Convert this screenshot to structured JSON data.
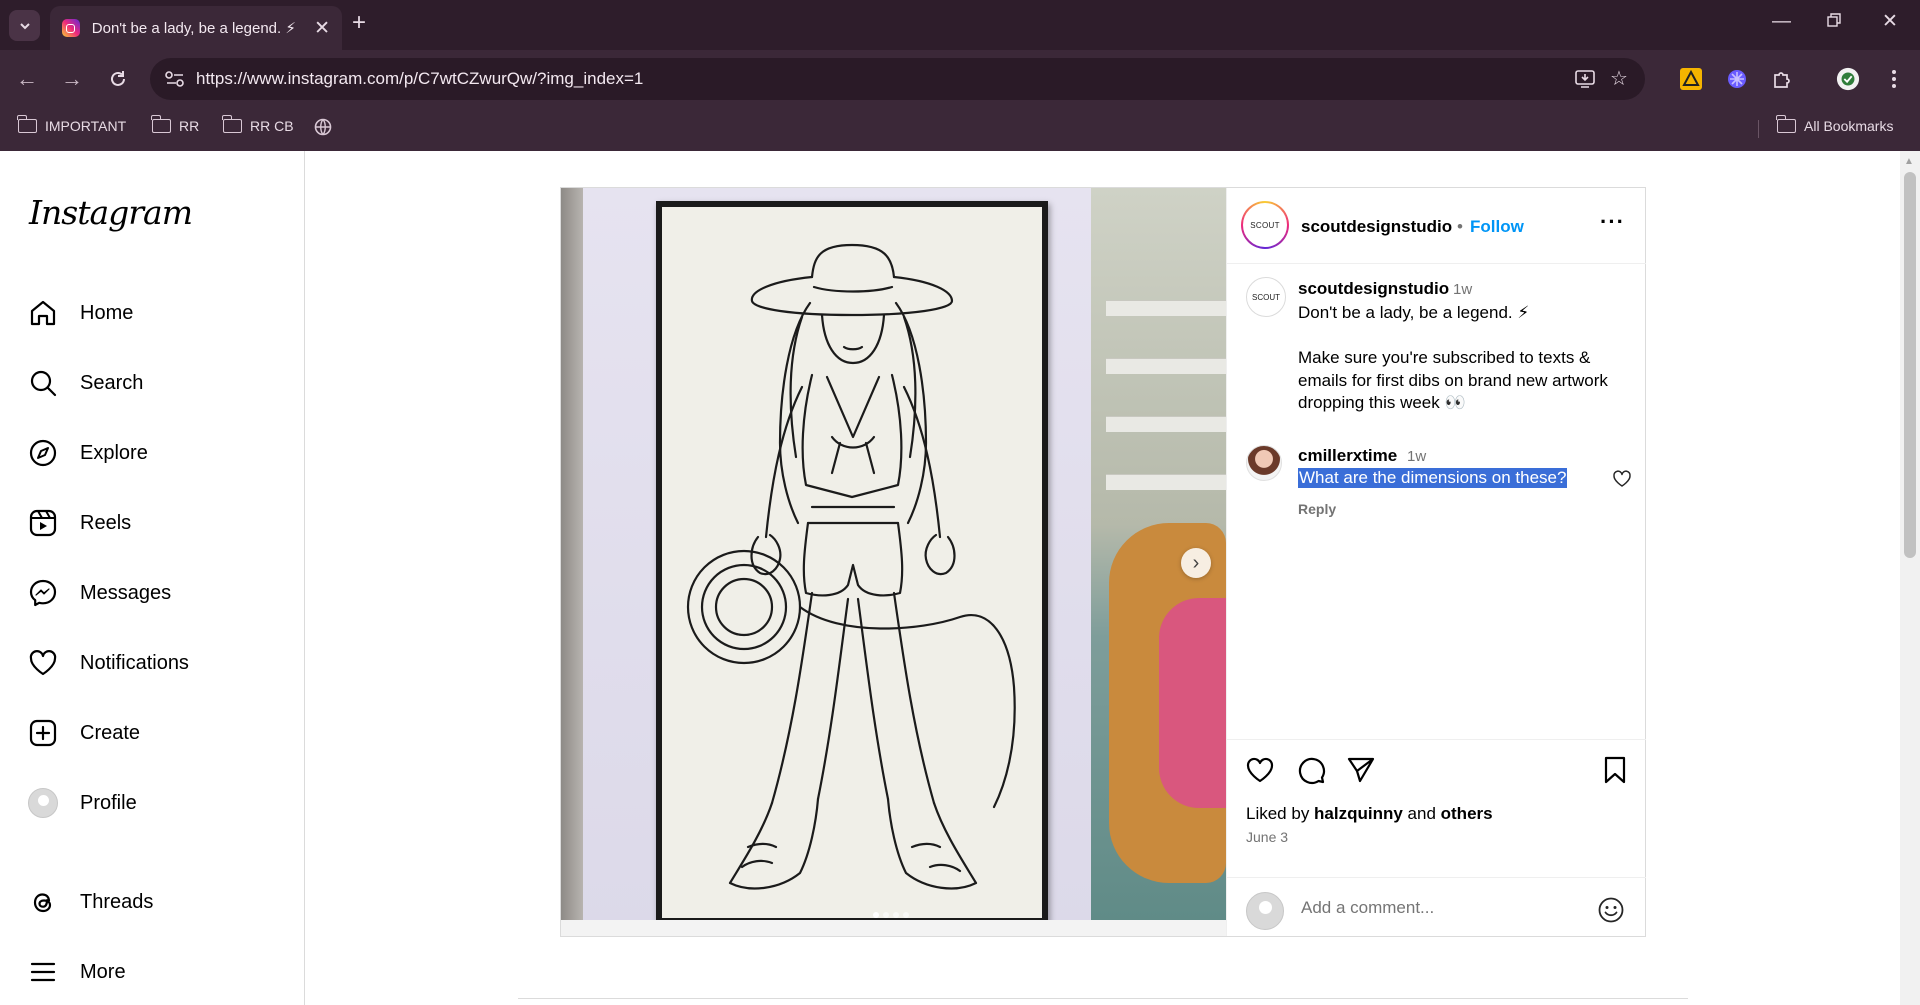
{
  "browser": {
    "tab_title": "Don't be a lady, be a legend. ⚡",
    "url": "https://www.instagram.com/p/C7wtCZwurQw/?img_index=1",
    "bookmarks": [
      "IMPORTANT",
      "RR",
      "RR CB"
    ],
    "all_bookmarks": "All Bookmarks"
  },
  "sidebar": {
    "logo": "Instagram",
    "items": [
      {
        "label": "Home",
        "icon": "home-icon"
      },
      {
        "label": "Search",
        "icon": "search-icon"
      },
      {
        "label": "Explore",
        "icon": "compass-icon"
      },
      {
        "label": "Reels",
        "icon": "reels-icon"
      },
      {
        "label": "Messages",
        "icon": "messenger-icon"
      },
      {
        "label": "Notifications",
        "icon": "heart-icon"
      },
      {
        "label": "Create",
        "icon": "plus-square-icon"
      },
      {
        "label": "Profile",
        "icon": "avatar"
      },
      {
        "label": "Threads",
        "icon": "threads-icon"
      },
      {
        "label": "More",
        "icon": "menu-icon"
      }
    ]
  },
  "post": {
    "username": "scoutdesignstudio",
    "follow": "Follow",
    "avatar_text": "SCOUT",
    "caption": {
      "username": "scoutdesignstudio",
      "time": "1w",
      "text": "Don't be a lady, be a legend. ⚡\n\nMake sure you're subscribed to texts & emails for first dibs on brand new artwork dropping this week 👀"
    },
    "comment": {
      "username": "cmillerxtime",
      "time": "1w",
      "text": "What are the dimensions on these?",
      "reply": "Reply"
    },
    "liked_prefix": "Liked by ",
    "liked_user": "halzquinny",
    "liked_and": " and ",
    "liked_others": "others",
    "date": "June 3",
    "comment_placeholder": "Add a comment...",
    "carousel_count": 4,
    "carousel_index": 1
  },
  "colors": {
    "chrome_bg": "#3b2838",
    "tabstrip_bg": "#2e1d2b",
    "follow_blue": "#0095f6",
    "selection": "#3a6ed8"
  }
}
